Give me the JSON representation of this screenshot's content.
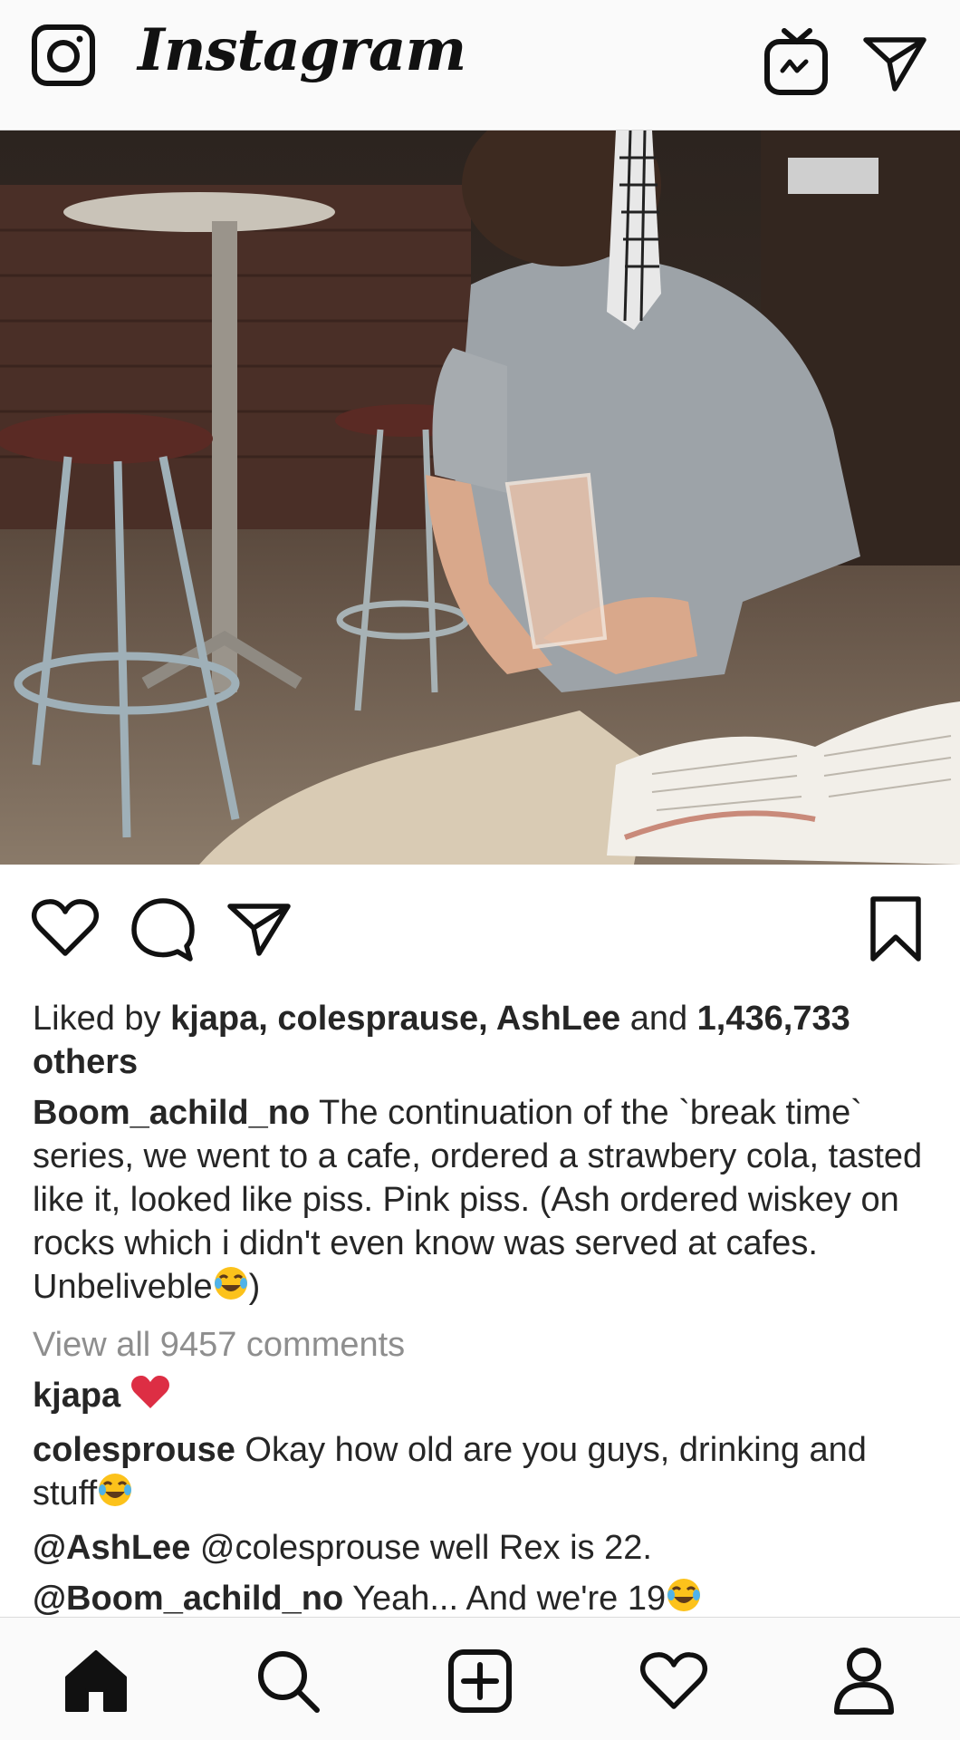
{
  "app": {
    "logo_text": "Instagram"
  },
  "topbar": {
    "icons": [
      "camera-icon",
      "igtv-icon",
      "direct-message-icon"
    ]
  },
  "post": {
    "actions": [
      "heart-icon",
      "comment-icon",
      "share-icon",
      "bookmark-icon"
    ],
    "likes": {
      "prefix": "Liked by ",
      "users": "kjapa, colesprause, AshLee",
      "middle": " and ",
      "count": "1,436,733 others"
    },
    "caption": {
      "username": "Boom_achild_no",
      "text": " The continuation of the `break time` series, we went to a cafe, ordered a strawbery cola, tasted like it, looked like piss. Pink piss. (Ash ordered wiskey on rocks which i didn't even know was served at cafes. Unbeliveble",
      "suffix": ")"
    },
    "view_all": "View all 9457 comments",
    "comments": [
      {
        "username": "kjapa",
        "text": " ",
        "emoji": "red-heart-emoji"
      },
      {
        "username": "colesprouse",
        "text": " Okay how old are you guys, drinking and stuff",
        "emoji": "tears-of-joy-emoji"
      },
      {
        "username": "@AshLee",
        "text": " @colesprouse well Rex is 22.",
        "emoji": ""
      },
      {
        "username": "@Boom_achild_no",
        "text": " Yeah... And we're 19",
        "emoji": "tears-of-joy-emoji"
      }
    ]
  },
  "bottomnav": {
    "items": [
      "home-icon",
      "search-icon",
      "new-post-icon",
      "activity-heart-icon",
      "profile-icon"
    ]
  },
  "colors": {
    "text": "#262626",
    "muted": "#8e8e8e",
    "bar_bg": "#fafafa",
    "heart_red": "#ed4956",
    "emoji_yellow": "#fcc21b"
  }
}
